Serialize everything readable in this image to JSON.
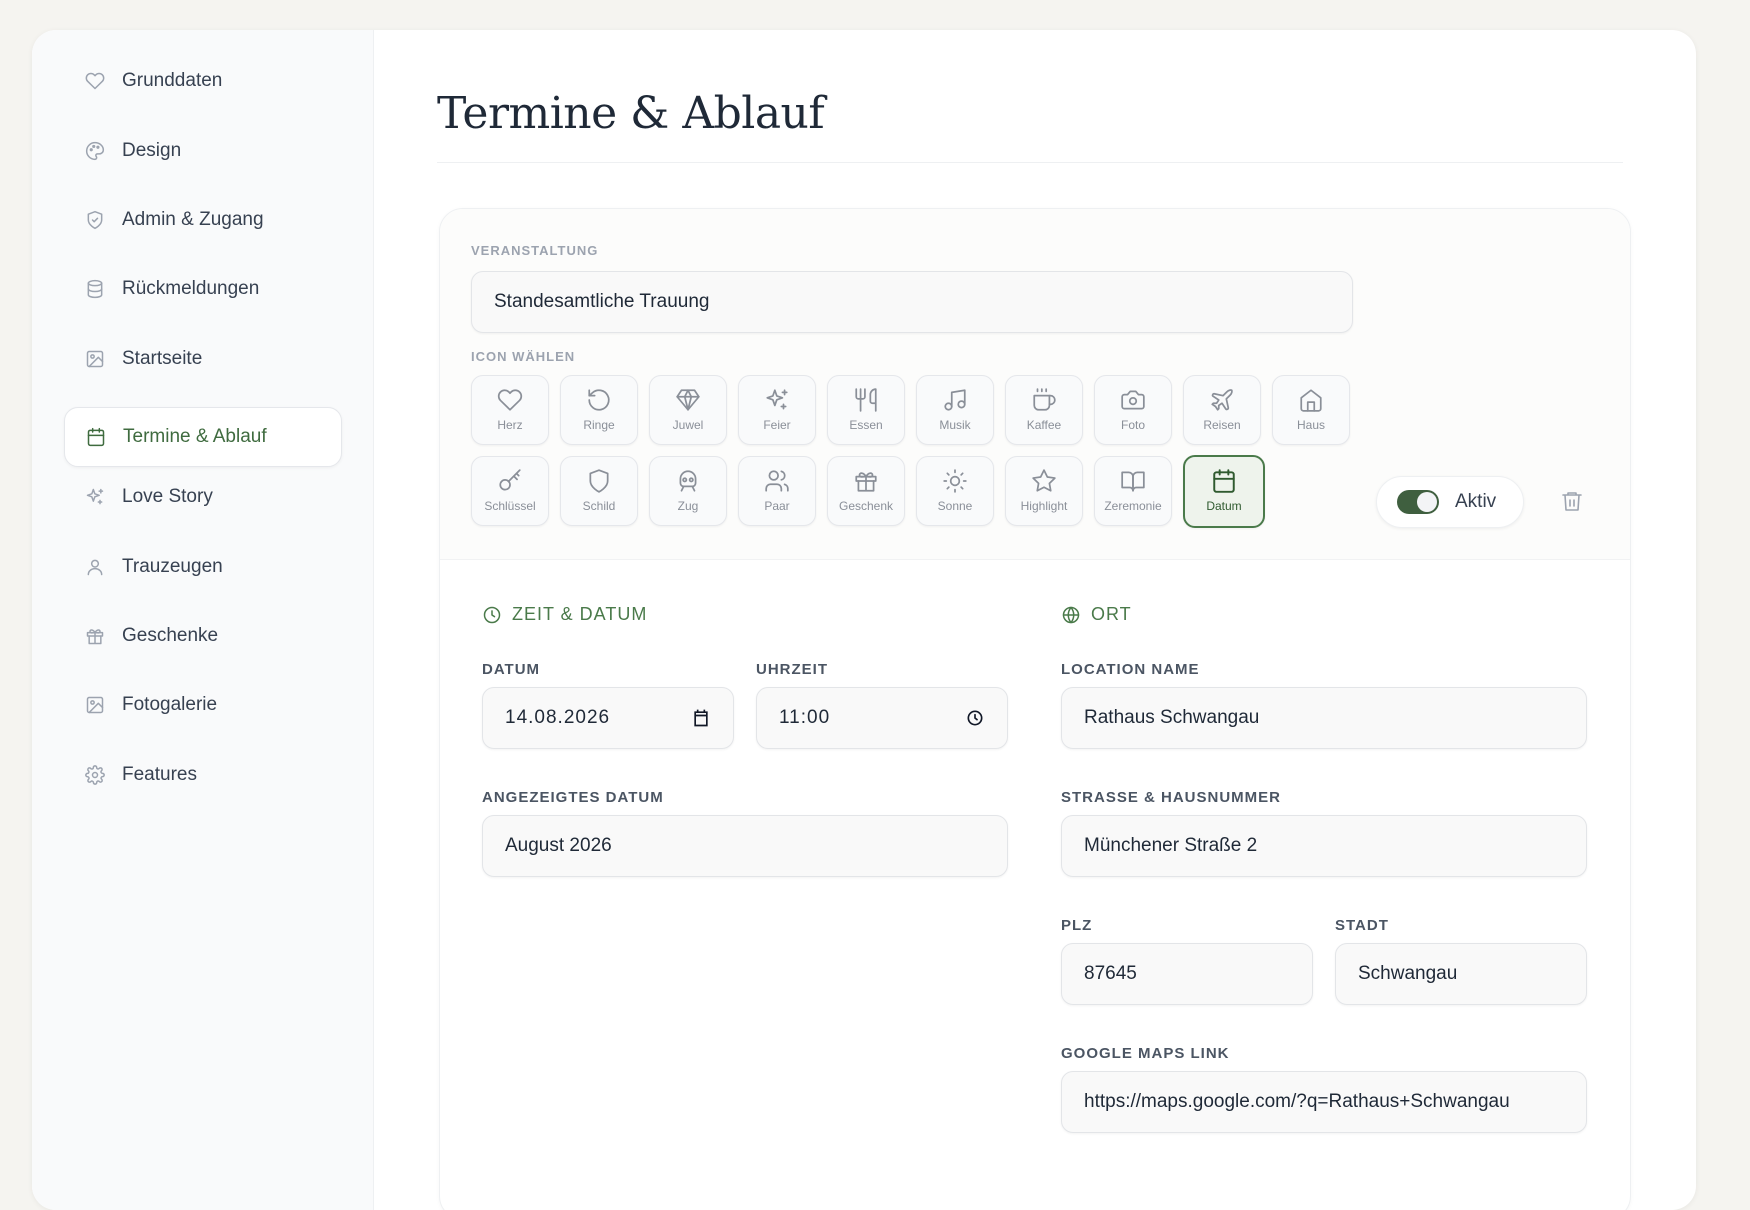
{
  "sidebar": {
    "items": [
      {
        "label": "Grunddaten",
        "icon": "heart-icon"
      },
      {
        "label": "Design",
        "icon": "palette-icon"
      },
      {
        "label": "Admin & Zugang",
        "icon": "shield-check-icon"
      },
      {
        "label": "Rückmeldungen",
        "icon": "database-icon"
      },
      {
        "label": "Startseite",
        "icon": "image-icon"
      },
      {
        "label": "Termine & Ablauf",
        "icon": "calendar-icon",
        "active": true
      },
      {
        "label": "Love Story",
        "icon": "sparkles-icon"
      },
      {
        "label": "Trauzeugen",
        "icon": "user-icon"
      },
      {
        "label": "Geschenke",
        "icon": "gift-icon"
      },
      {
        "label": "Fotogalerie",
        "icon": "image-icon"
      },
      {
        "label": "Features",
        "icon": "gear-icon"
      }
    ]
  },
  "page": {
    "title": "Termine & Ablauf"
  },
  "event": {
    "label": "VERANSTALTUNG",
    "value": "Standesamtliche Trauung",
    "icon_label": "ICON WÄHLEN",
    "icons": [
      {
        "label": "Herz",
        "icon": "heart-icon"
      },
      {
        "label": "Ringe",
        "icon": "rotate-icon"
      },
      {
        "label": "Juwel",
        "icon": "gem-icon"
      },
      {
        "label": "Feier",
        "icon": "sparkles-icon"
      },
      {
        "label": "Essen",
        "icon": "utensils-icon"
      },
      {
        "label": "Musik",
        "icon": "music-icon"
      },
      {
        "label": "Kaffee",
        "icon": "coffee-icon"
      },
      {
        "label": "Foto",
        "icon": "camera-icon"
      },
      {
        "label": "Reisen",
        "icon": "plane-icon"
      },
      {
        "label": "Haus",
        "icon": "house-icon"
      },
      {
        "label": "Schlüssel",
        "icon": "key-icon"
      },
      {
        "label": "Schild",
        "icon": "shield-icon"
      },
      {
        "label": "Zug",
        "icon": "train-icon"
      },
      {
        "label": "Paar",
        "icon": "users-icon"
      },
      {
        "label": "Geschenk",
        "icon": "gift-icon"
      },
      {
        "label": "Sonne",
        "icon": "sun-icon"
      },
      {
        "label": "Highlight",
        "icon": "star-icon"
      },
      {
        "label": "Zeremonie",
        "icon": "book-open-icon"
      },
      {
        "label": "Datum",
        "icon": "calendar-icon",
        "selected": true
      }
    ],
    "toggle_label": "Aktiv",
    "toggle_on": true,
    "accent_color": "#3f6b3f"
  },
  "time": {
    "section_title": "ZEIT & DATUM",
    "date_label": "DATUM",
    "date_value": "14.08.2026",
    "time_label": "UHRZEIT",
    "time_value": "11:00",
    "display_date_label": "ANGEZEIGTES DATUM",
    "display_date_value": "August 2026"
  },
  "place": {
    "section_title": "ORT",
    "location_label": "LOCATION NAME",
    "location_value": "Rathaus Schwangau",
    "street_label": "STRASSE & HAUSNUMMER",
    "street_value": "Münchener Straße 2",
    "zip_label": "PLZ",
    "zip_value": "87645",
    "city_label": "STADT",
    "city_value": "Schwangau",
    "maps_label": "GOOGLE MAPS LINK",
    "maps_value": "https://maps.google.com/?q=Rathaus+Schwangau"
  }
}
